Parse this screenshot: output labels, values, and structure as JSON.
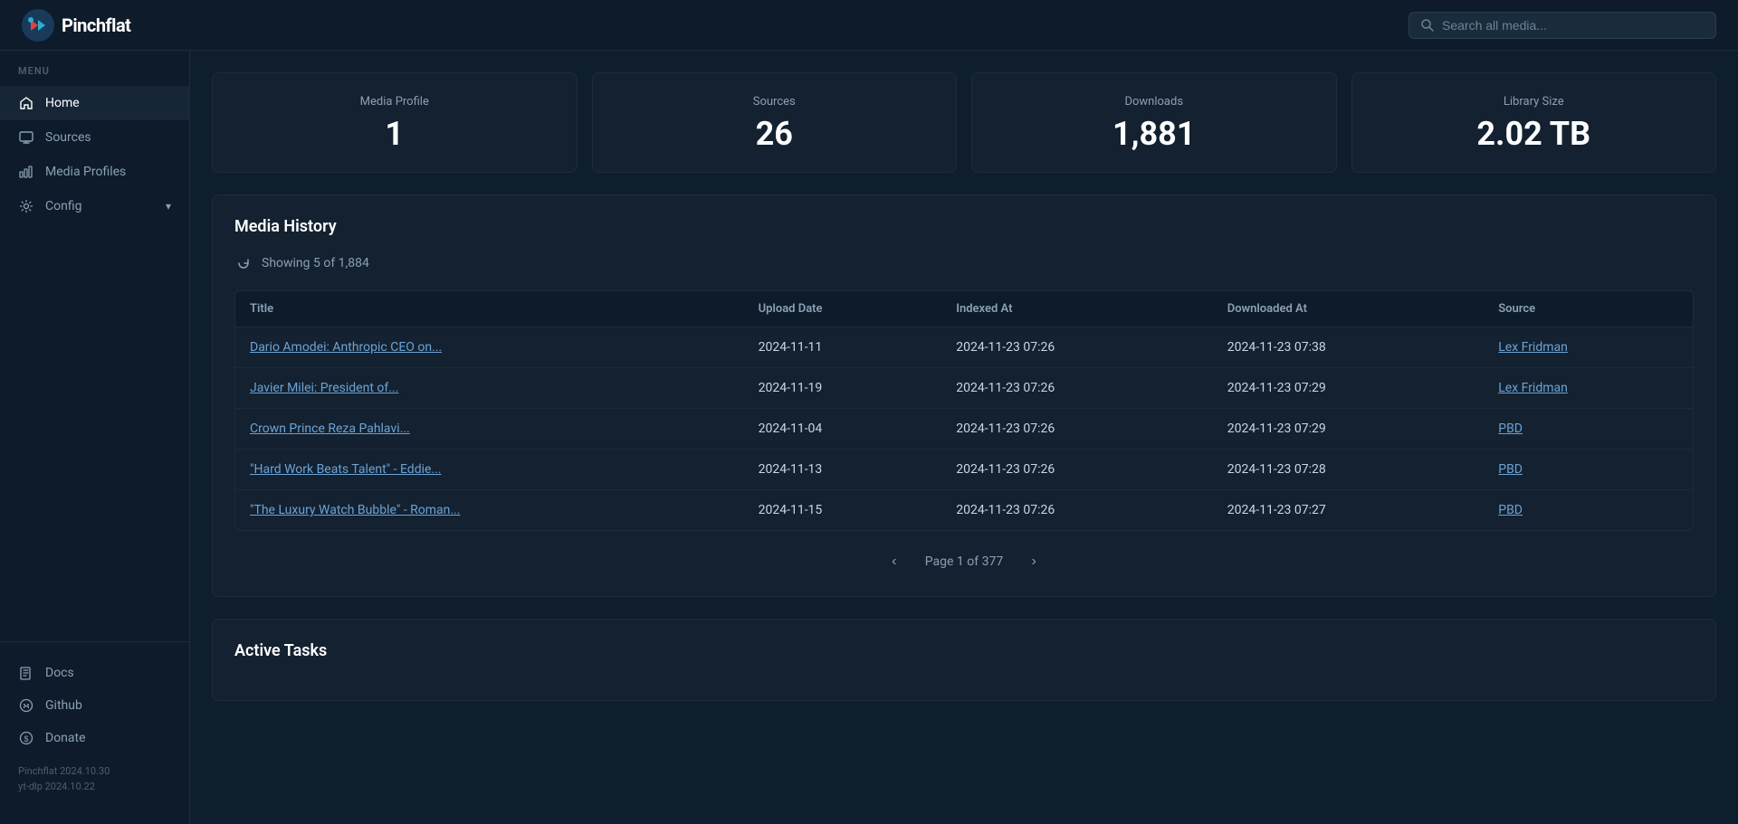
{
  "app": {
    "name": "Pinchflat",
    "logo_alt": "Pinchflat logo"
  },
  "topbar": {
    "search_placeholder": "Search all media..."
  },
  "sidebar": {
    "menu_label": "MENU",
    "nav_items": [
      {
        "id": "home",
        "label": "Home",
        "icon": "home"
      },
      {
        "id": "sources",
        "label": "Sources",
        "icon": "monitor"
      },
      {
        "id": "media-profiles",
        "label": "Media Profiles",
        "icon": "bar-chart"
      }
    ],
    "config_label": "Config",
    "bottom_items": [
      {
        "id": "docs",
        "label": "Docs",
        "icon": "book"
      },
      {
        "id": "github",
        "label": "Github",
        "icon": "circle"
      },
      {
        "id": "donate",
        "label": "Donate",
        "icon": "dollar"
      }
    ],
    "version1": "Pinchflat 2024.10.30",
    "version2": "yt-dlp 2024.10.22"
  },
  "stats": [
    {
      "label": "Media Profile",
      "value": "1"
    },
    {
      "label": "Sources",
      "value": "26"
    },
    {
      "label": "Downloads",
      "value": "1,881"
    },
    {
      "label": "Library Size",
      "value": "2.02 TB"
    }
  ],
  "media_history": {
    "title": "Media History",
    "showing_text": "Showing 5 of 1,884",
    "columns": [
      "Title",
      "Upload Date",
      "Indexed At",
      "Downloaded At",
      "Source"
    ],
    "rows": [
      {
        "title": "Dario Amodei: Anthropic CEO on...",
        "upload_date": "2024-11-11",
        "indexed_at": "2024-11-23 07:26",
        "downloaded_at": "2024-11-23 07:38",
        "source": "Lex Fridman"
      },
      {
        "title": "Javier Milei: President of...",
        "upload_date": "2024-11-19",
        "indexed_at": "2024-11-23 07:26",
        "downloaded_at": "2024-11-23 07:29",
        "source": "Lex Fridman"
      },
      {
        "title": "Crown Prince Reza Pahlavi...",
        "upload_date": "2024-11-04",
        "indexed_at": "2024-11-23 07:26",
        "downloaded_at": "2024-11-23 07:29",
        "source": "PBD"
      },
      {
        "title": "\"Hard Work Beats Talent\" - Eddie...",
        "upload_date": "2024-11-13",
        "indexed_at": "2024-11-23 07:26",
        "downloaded_at": "2024-11-23 07:28",
        "source": "PBD"
      },
      {
        "title": "\"The Luxury Watch Bubble\" - Roman...",
        "upload_date": "2024-11-15",
        "indexed_at": "2024-11-23 07:26",
        "downloaded_at": "2024-11-23 07:27",
        "source": "PBD"
      }
    ],
    "pagination": {
      "current_page": 1,
      "total_pages": 377,
      "page_label": "Page 1 of 377"
    }
  },
  "active_tasks": {
    "title": "Active Tasks"
  }
}
